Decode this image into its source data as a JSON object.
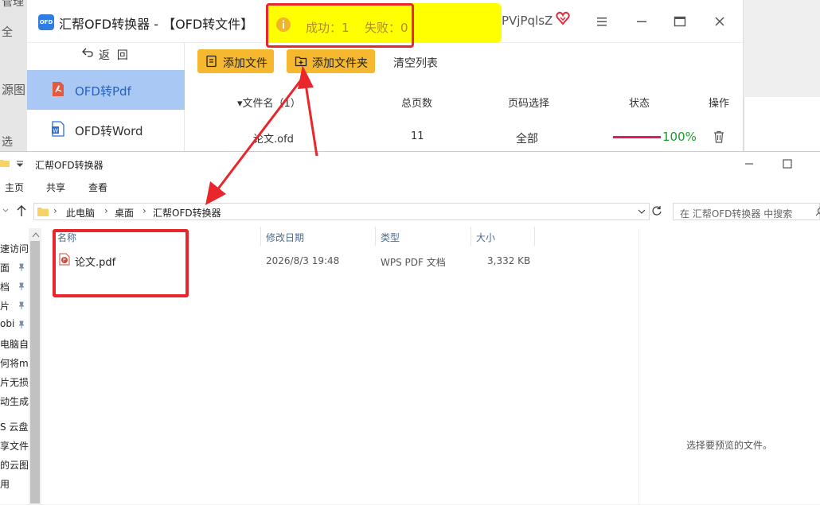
{
  "background": {
    "left_fragments": [
      "管理",
      "全",
      "源图",
      "选"
    ]
  },
  "app": {
    "logo_text": "OFD",
    "title": "汇帮OFD转换器 - 【OFD转文件】",
    "user_id": "PVjPqlsZ",
    "notice": {
      "success": "成功：1",
      "fail": "失败：0",
      "bg_color": "#ffff00",
      "border_color": "#e8262c"
    },
    "back_label": "返  回",
    "sidebar": [
      {
        "label": "OFD转Pdf",
        "icon": "pdf-icon",
        "active": true
      },
      {
        "label": "OFD转Word",
        "icon": "word-icon",
        "active": false
      }
    ],
    "toolbar": {
      "add_file": "添加文件",
      "add_folder": "添加文件夹",
      "clear_list": "清空列表"
    },
    "table": {
      "headers": {
        "name": "▾文件名（1）",
        "pages": "总页数",
        "page_select": "页码选择",
        "status": "状态",
        "actions": "操作"
      },
      "rows": [
        {
          "name": "论文.ofd",
          "pages": "11",
          "page_select": "全部",
          "progress": 100,
          "progress_text": "100%"
        }
      ]
    },
    "accent_color": "#f5b82e",
    "active_color": "#a9c9f4"
  },
  "explorer": {
    "title": "汇帮OFD转换器",
    "ribbon_tabs": [
      "主页",
      "共享",
      "查看"
    ],
    "breadcrumb": [
      "此电脑",
      "桌面",
      "汇帮OFD转换器"
    ],
    "search_placeholder": "在 汇帮OFD转换器 中搜索",
    "nav_items": [
      "速访问",
      "面",
      "档",
      "片",
      "obi",
      "电脑自",
      "何将m",
      "片无损",
      "动生成",
      "S 云盘",
      "享文件",
      "的云图",
      "用"
    ],
    "columns": {
      "name": "名称",
      "date": "修改日期",
      "type": "类型",
      "size": "大小"
    },
    "files": [
      {
        "name": "论文.pdf",
        "date": "2026/8/3 19:48",
        "type": "WPS PDF 文档",
        "size": "3,332 KB",
        "icon": "pdf-file-icon"
      }
    ],
    "preview_text": "选择要预览的文件。"
  }
}
